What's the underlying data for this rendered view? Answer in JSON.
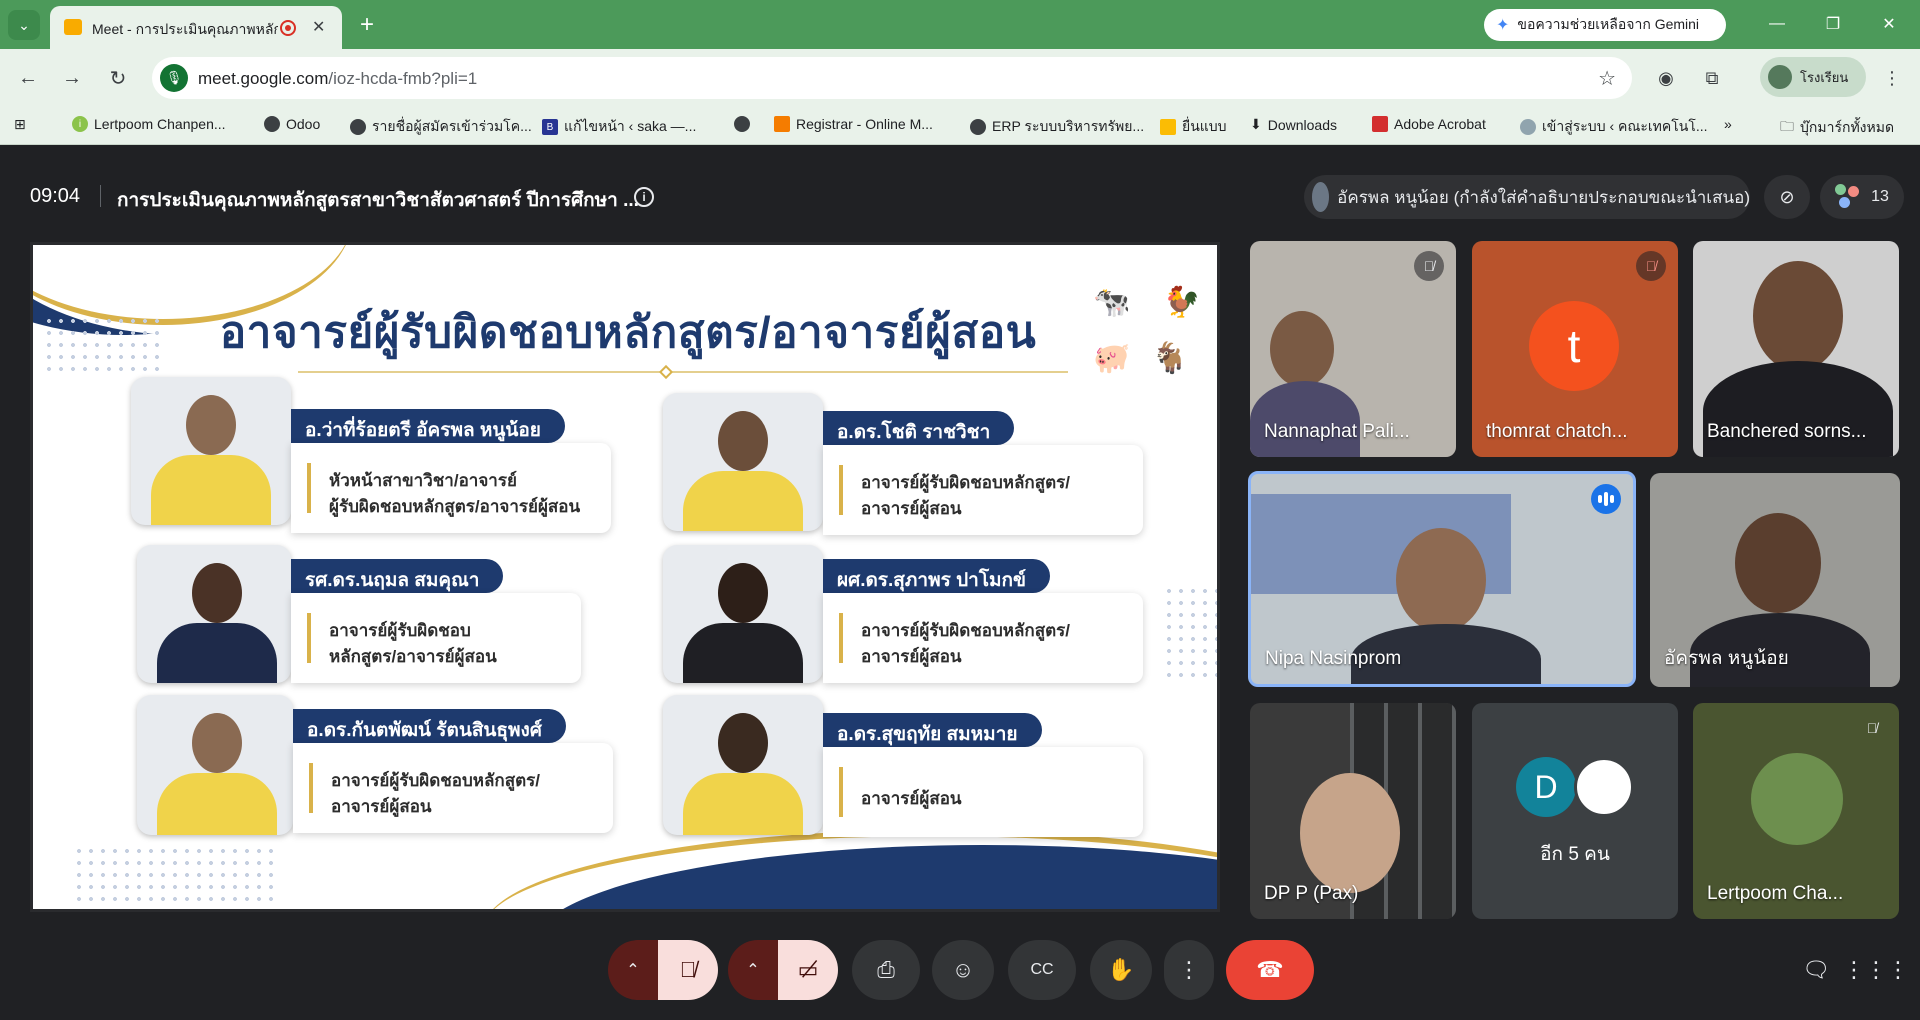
{
  "browser": {
    "tab_title": "Meet - การประเมินคุณภาพหลักสูตร",
    "gemini_button": "ขอความช่วยเหลือจาก Gemini",
    "url_host": "meet.google.com",
    "url_path": "/ioz-hcda-fmb?pli=1",
    "profile_label": "โรงเรียน",
    "bookmarks": [
      "Lertpoom Chanpen...",
      "Odoo",
      "รายชื่อผู้สมัครเข้าร่วมโค...",
      "แก้ไขหน้า ‹ saka —...",
      "Registrar - Online M...",
      "ERP ระบบบริหารทรัพย...",
      "ยื่นแบบ",
      "Downloads",
      "Adobe Acrobat",
      "เข้าสู่ระบบ ‹ คณะเทคโนโ..."
    ],
    "all_bookmarks": "บุ๊กมาร์กทั้งหมด"
  },
  "meet": {
    "time": "09:04",
    "title": "การประเมินคุณภาพหลักสูตรสาขาวิชาสัตวศาสตร์ ปีการศึกษา ...",
    "presenter_chip": "อัครพล หนูน้อย (กำลังใส่คำอธิบายประกอบขณะนำเสนอ)",
    "participant_count": "13",
    "more_label": "อีก 5 คน",
    "more_initial": "D"
  },
  "slide": {
    "title": "อาจารย์ผู้รับผิดชอบหลักสูตร/อาจารย์ผู้สอน",
    "cards": [
      {
        "name": "อ.ว่าที่ร้อยตรี อัครพล หนูน้อย",
        "line1": "หัวหน้าสาขาวิชา/อาจารย์",
        "line2": "ผู้รับผิดชอบหลักสูตร/อาจารย์ผู้สอน"
      },
      {
        "name": "อ.ดร.โชติ ราชวิชา",
        "line1": "อาจารย์ผู้รับผิดชอบหลักสูตร/",
        "line2": "อาจารย์ผู้สอน"
      },
      {
        "name": "รศ.ดร.นฤมล สมคุณา",
        "line1": "อาจารย์ผู้รับผิดชอบ",
        "line2": "หลักสูตร/อาจารย์ผู้สอน"
      },
      {
        "name": "ผศ.ดร.สุภาพร ปาโมกข์",
        "line1": "อาจารย์ผู้รับผิดชอบหลักสูตร/",
        "line2": "อาจารย์ผู้สอน"
      },
      {
        "name": "อ.ดร.กันตพัฒน์ รัตนสินธุพงศ์",
        "line1": "อาจารย์ผู้รับผิดชอบหลักสูตร/",
        "line2": "อาจารย์ผู้สอน"
      },
      {
        "name": "อ.ดร.สุขฤทัย สมหมาย",
        "line1": "อาจารย์ผู้สอน",
        "line2": ""
      }
    ]
  },
  "participants": [
    {
      "name": "Nannaphat Pali...",
      "muted": true
    },
    {
      "name": "thomrat chatch...",
      "muted": true,
      "initial": "t"
    },
    {
      "name": "Banchered sorns...",
      "muted": false
    },
    {
      "name": "Nipa Nasinprom",
      "speaking": true
    },
    {
      "name": "อัครพล หนูน้อย",
      "muted": false
    },
    {
      "name": "DP P (Pax)",
      "muted": false
    },
    {
      "name": "Lertpoom Cha...",
      "muted": true
    }
  ],
  "colors": {
    "chrome_green": "#4c9a5a",
    "slide_navy": "#1e3a6e",
    "slide_gold": "#d9b24a",
    "meet_bg": "#202124",
    "end_call_red": "#ea4335",
    "mic_off_pink": "#f9dedc"
  },
  "icons": [
    "mic-off-icon",
    "camera-off-icon",
    "present-icon",
    "emoji-icon",
    "captions-icon",
    "raise-hand-icon",
    "more-icon",
    "end-call-icon",
    "chat-icon",
    "activities-icon"
  ]
}
